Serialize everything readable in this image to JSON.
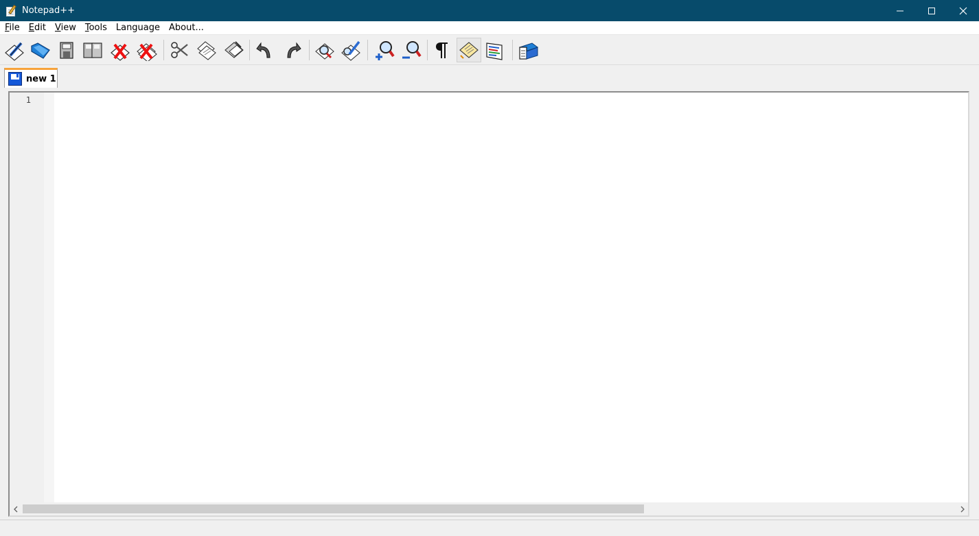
{
  "window": {
    "title": "Notepad++",
    "controls": {
      "minimize": "—",
      "maximize": "☐",
      "close": "✕"
    }
  },
  "menu": {
    "items": [
      {
        "mnemonic": "F",
        "rest": "ile"
      },
      {
        "mnemonic": "E",
        "rest": "dit"
      },
      {
        "mnemonic": "V",
        "rest": "iew"
      },
      {
        "mnemonic": "T",
        "rest": "ools"
      },
      {
        "mnemonic": "",
        "rest": "Language"
      },
      {
        "mnemonic": "",
        "rest": "About..."
      }
    ]
  },
  "toolbar": {
    "buttons": [
      {
        "name": "new-file",
        "icon": "pencil-paper-icon"
      },
      {
        "name": "open-file",
        "icon": "folder-icon"
      },
      {
        "name": "save",
        "icon": "floppy-icon"
      },
      {
        "name": "save-all",
        "icon": "floppies-icon"
      },
      {
        "name": "close",
        "icon": "close-doc-icon"
      },
      {
        "name": "close-all",
        "icon": "close-all-icon"
      },
      {
        "name": "cut",
        "icon": "scissors-icon"
      },
      {
        "name": "copy",
        "icon": "copy-icon"
      },
      {
        "name": "paste",
        "icon": "paste-icon"
      },
      {
        "name": "undo",
        "icon": "undo-icon"
      },
      {
        "name": "redo",
        "icon": "redo-icon"
      },
      {
        "name": "find",
        "icon": "find-icon"
      },
      {
        "name": "replace",
        "icon": "replace-icon"
      },
      {
        "name": "zoom-in",
        "icon": "zoom-in-icon"
      },
      {
        "name": "zoom-out",
        "icon": "zoom-out-icon"
      },
      {
        "name": "show-all-chars",
        "icon": "pilcrow-icon"
      },
      {
        "name": "word-wrap",
        "icon": "notepad-icon",
        "active": true
      },
      {
        "name": "user-lang",
        "icon": "lang-icon"
      },
      {
        "name": "about",
        "icon": "book-icon"
      }
    ]
  },
  "tabs": [
    {
      "label": "new 1"
    }
  ],
  "editor": {
    "line_numbers": [
      "1"
    ]
  }
}
